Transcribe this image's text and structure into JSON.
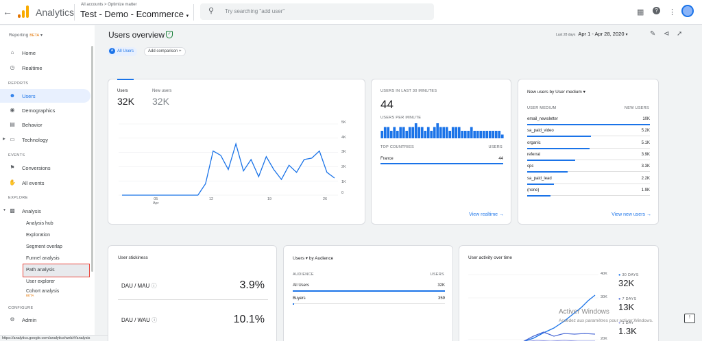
{
  "topbar": {
    "app_title": "Analytics",
    "breadcrumb": "All accounts > Optimize matter",
    "property": "Test - Demo - Ecommerce",
    "search_placeholder": "Try searching \"add user\"",
    "brand_colors": [
      "#f9ab00",
      "#e37400"
    ]
  },
  "sidebar": {
    "reporting_label": "Reporting",
    "reporting_badge": "BETA",
    "top_items": [
      {
        "label": "Home",
        "icon": "home-icon"
      },
      {
        "label": "Realtime",
        "icon": "clock-icon"
      }
    ],
    "reports_header": "REPORTS",
    "report_items": [
      {
        "label": "Users",
        "icon": "person-icon"
      },
      {
        "label": "Demographics",
        "icon": "globe-icon"
      },
      {
        "label": "Behavior",
        "icon": "behavior-icon"
      },
      {
        "label": "Technology",
        "icon": "device-icon"
      }
    ],
    "events_header": "EVENTS",
    "event_items": [
      {
        "label": "Conversions",
        "icon": "flag-icon"
      },
      {
        "label": "All events",
        "icon": "hand-icon"
      }
    ],
    "explore_header": "EXPLORE",
    "analysis_label": "Analysis",
    "analysis_subitems": [
      "Analysis hub",
      "Exploration",
      "Segment overlap",
      "Funnel analysis",
      "Path analysis",
      "User explorer",
      "Cohort analysis"
    ],
    "cohort_badge": "BETA",
    "configure_header": "CONFIGURE",
    "admin_label": "Admin"
  },
  "status_url": "https://analytics.google.com/analytics/web/#/analysis",
  "main": {
    "title": "Users overview",
    "chip_all_users": "All Users",
    "chip_all_users_letter": "A",
    "chip_add": "Add comparison",
    "date_label": "Last 28 days",
    "date_range": "Apr 1 - Apr 28, 2020"
  },
  "users_card": {
    "tab1_label": "Users",
    "tab1_value": "32K",
    "tab2_label": "New users",
    "tab2_value": "32K",
    "y_ticks": [
      "5K",
      "4K",
      "3K",
      "2K",
      "1K",
      "0"
    ],
    "x_ticks": [
      "05",
      "12",
      "19",
      "26"
    ],
    "x_sub": "Apr"
  },
  "chart_data": {
    "type": "line",
    "x": [
      1,
      2,
      3,
      4,
      5,
      6,
      7,
      8,
      9,
      10,
      11,
      12,
      13,
      14,
      15,
      16,
      17,
      18,
      19,
      20,
      21,
      22,
      23,
      24,
      25,
      26,
      27,
      28
    ],
    "series": [
      {
        "values": [
          0,
          0,
          0,
          0,
          0,
          0,
          0,
          0,
          0,
          0,
          0,
          800,
          3100,
          2800,
          1800,
          3600,
          1700,
          2500,
          1300,
          2700,
          1800,
          1100,
          2100,
          1600,
          2500,
          2600,
          3100,
          1600,
          1200
        ]
      }
    ],
    "ylim": [
      0,
      5000
    ],
    "color": "#1a73e8"
  },
  "realtime_card": {
    "title": "USERS IN LAST 30 MINUTES",
    "value": "44",
    "per_minute_label": "USERS PER MINUTE",
    "bars": [
      2,
      3,
      3,
      2,
      3,
      2,
      3,
      3,
      2,
      3,
      3,
      4,
      3,
      3,
      2,
      3,
      2,
      3,
      4,
      3,
      3,
      3,
      2,
      3,
      3,
      3,
      2,
      2,
      2,
      3,
      2,
      2,
      2,
      2,
      2,
      2,
      2,
      2,
      2,
      1
    ],
    "countries_header": "TOP COUNTRIES",
    "users_header": "USERS",
    "rows": [
      {
        "country": "France",
        "users": "44"
      }
    ],
    "link": "View realtime"
  },
  "medium_card": {
    "title": "New users by User medium",
    "col1": "USER MEDIUM",
    "col2": "NEW USERS",
    "rows": [
      {
        "medium": "email_newsletter",
        "value": "10K",
        "share": 1.0
      },
      {
        "medium": "sa_paid_video",
        "value": "5.2K",
        "share": 0.52
      },
      {
        "medium": "organic",
        "value": "5.1K",
        "share": 0.51
      },
      {
        "medium": "referral",
        "value": "3.9K",
        "share": 0.39
      },
      {
        "medium": "cpc",
        "value": "3.3K",
        "share": 0.33
      },
      {
        "medium": "sa_paid_lead",
        "value": "2.2K",
        "share": 0.22
      },
      {
        "medium": "(none)",
        "value": "1.9K",
        "share": 0.19
      }
    ],
    "link": "View new users"
  },
  "stickiness_card": {
    "title": "User stickiness",
    "rows": [
      {
        "label": "DAU / MAU",
        "value": "3.9%"
      },
      {
        "label": "DAU / WAU",
        "value": "10.1%"
      }
    ]
  },
  "audience_card": {
    "title_metric": "Users",
    "title_dim": "by Audience",
    "col1": "AUDIENCE",
    "col2": "USERS",
    "rows": [
      {
        "audience": "All Users",
        "users": "32K",
        "share": 1.0
      },
      {
        "audience": "Buyers",
        "users": "359",
        "share": 0.011
      }
    ]
  },
  "activity_card": {
    "title": "User activity over time",
    "y_ticks": [
      "40K",
      "30K",
      "20K"
    ],
    "legend": [
      {
        "label": "30 DAYS",
        "value": "32K"
      },
      {
        "label": "7 DAYS",
        "value": "13K"
      },
      {
        "label": "1 DAY",
        "value": "1.3K"
      }
    ]
  },
  "windows_watermark": {
    "title": "Activer Windows",
    "subtitle": "Accédez aux paramètres pour activer Windows."
  }
}
